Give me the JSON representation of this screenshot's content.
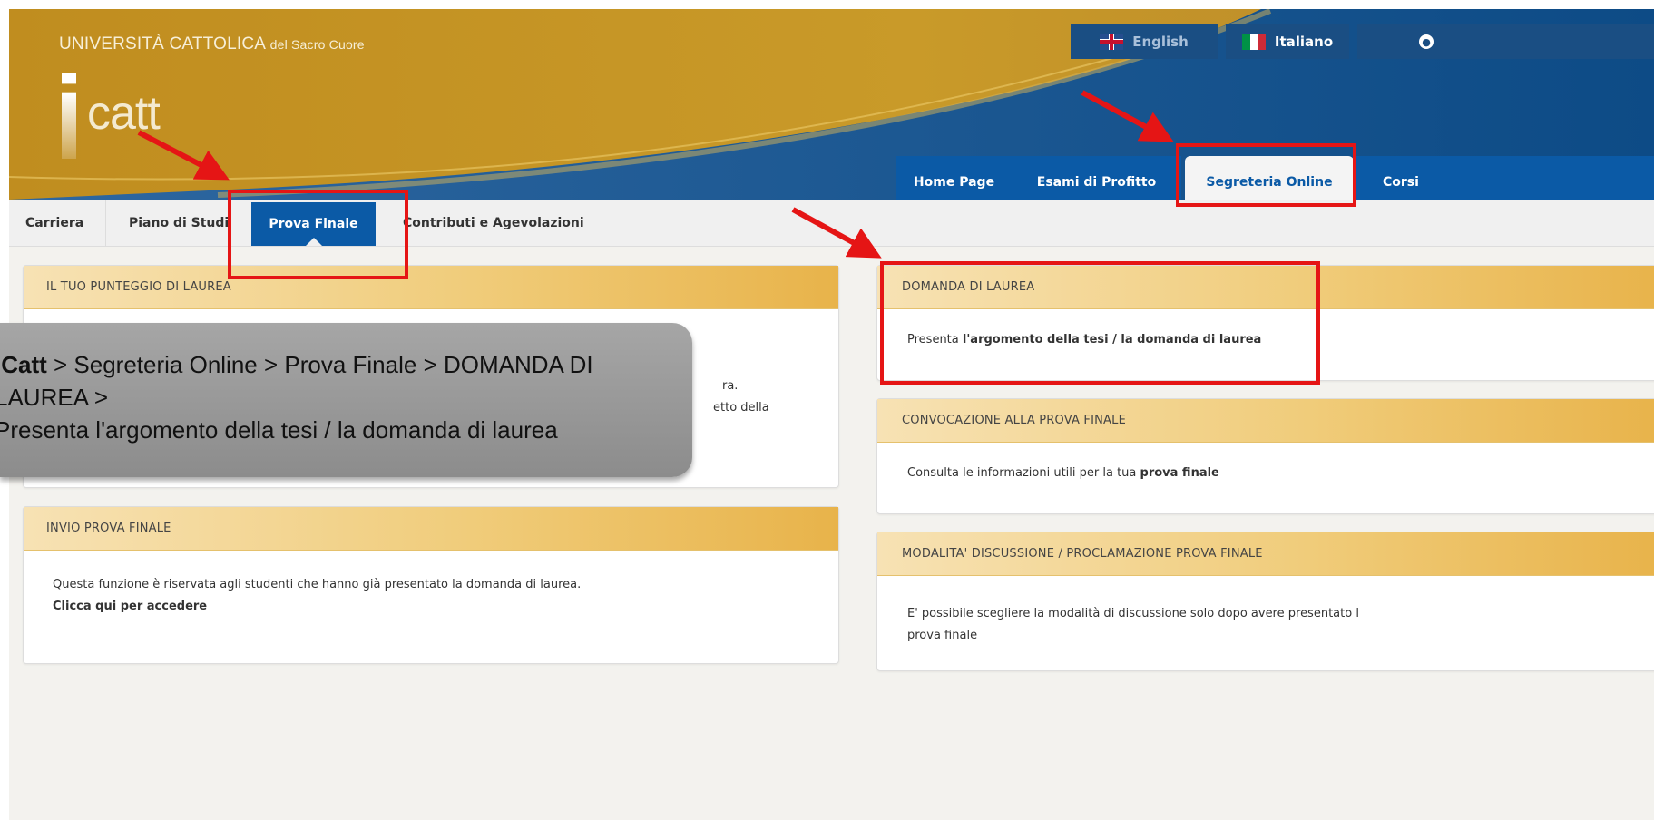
{
  "header": {
    "university_main": "UNIVERSITÀ CATTOLICA",
    "university_sub": "del Sacro Cuore",
    "logo_text": "catt",
    "lang_english": "English",
    "lang_italiano": "Italiano"
  },
  "main_nav": {
    "home": "Home Page",
    "esami": "Esami di Profitto",
    "segreteria": "Segreteria Online",
    "corsi": "Corsi"
  },
  "sub_nav": {
    "carriera": "Carriera",
    "piano": "Piano di Studi",
    "prova": "Prova Finale",
    "contributi": "Contributi e Agevolazioni"
  },
  "panels": {
    "punteggio": {
      "title": "IL TUO PUNTEGGIO DI LAUREA",
      "frag1": "ra.",
      "frag2": "etto della"
    },
    "invio": {
      "title": "INVIO PROVA FINALE",
      "text": "Questa funzione è riservata agli studenti che hanno già presentato la domanda di laurea.",
      "link": "Clicca qui per accedere"
    },
    "domanda": {
      "title": "DOMANDA DI LAUREA",
      "text_prefix": "Presenta ",
      "link": "l'argomento della tesi / la domanda di laurea"
    },
    "convocazione": {
      "title": "CONVOCAZIONE ALLA PROVA FINALE",
      "text_prefix": "Consulta le informazioni utili per la tua ",
      "link": "prova finale"
    },
    "modalita": {
      "title": "MODALITA' DISCUSSIONE / PROCLAMAZIONE PROVA FINALE",
      "text_line1": "E' possibile scegliere la modalità di discussione solo dopo avere presentato l",
      "text_line2": "prova finale"
    }
  },
  "callout": {
    "bold": "iCatt",
    "line1_rest": " > Segreteria Online > Prova Finale > DOMANDA DI",
    "line2": "LAUREA >",
    "line3": "Presenta l'argomento della tesi / la domanda di laurea"
  },
  "colors": {
    "header_gold": "#c79624",
    "nav_blue": "#0b5aa6",
    "highlight_red": "#e51515"
  }
}
